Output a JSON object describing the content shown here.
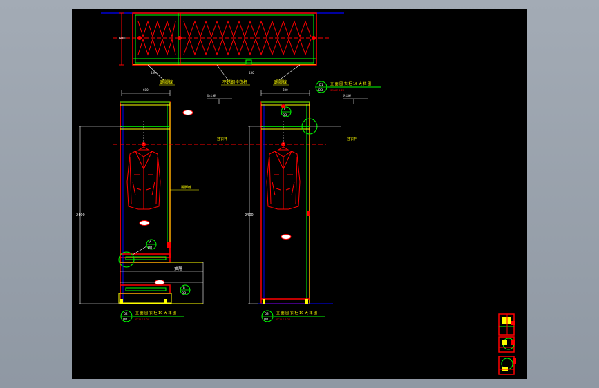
{
  "colors": {
    "background": "#000000",
    "frame": "#9ba3ad",
    "red": "#ff0000",
    "green": "#00ff00",
    "yellow": "#ffff00",
    "blue": "#0000ff",
    "white": "#ffffff"
  },
  "labels": {
    "plan_left_note": "踢脚線",
    "plan_center_note": "不锈钢挂衣杆",
    "plan_right_note": "踢脚線",
    "left_elev_note": "踢脚線",
    "left_drawer_note": "抽屉",
    "left_top_note": "防尘板",
    "right_top_note": "防尘板",
    "left_rail_note": "挂衣杆",
    "right_rail_note": "挂衣杆",
    "plan_title": "立 面 图 衣 柜 10 大 样 图",
    "plan_scale": "SCALE 1:20",
    "left_title": "立 面 图 衣 柜 10 大 样 图",
    "left_scale": "SCALE 1:20",
    "right_title": "立 面 图 衣 柜 10 大 样 图",
    "right_scale": "SCALE 1:20",
    "plan_tag_top": "D1",
    "plan_tag_bottom": "DD",
    "left_tag_top": "D2",
    "left_tag_bottom": "DD",
    "right_tag_top": "D3",
    "right_tag_bottom": "DD",
    "callout_a_top": "A",
    "callout_a_bottom": "DD",
    "callout_b_top": "B",
    "callout_b_bottom": "DD",
    "callout_c_top": "C",
    "callout_c_bottom": "DD",
    "dim_height_left": "2400",
    "dim_height_right": "2400",
    "dim_width_left": "600",
    "dim_width_right": "600",
    "dim_plan_depth": "600",
    "dim_plan_left": "450",
    "dim_plan_right": "450"
  }
}
